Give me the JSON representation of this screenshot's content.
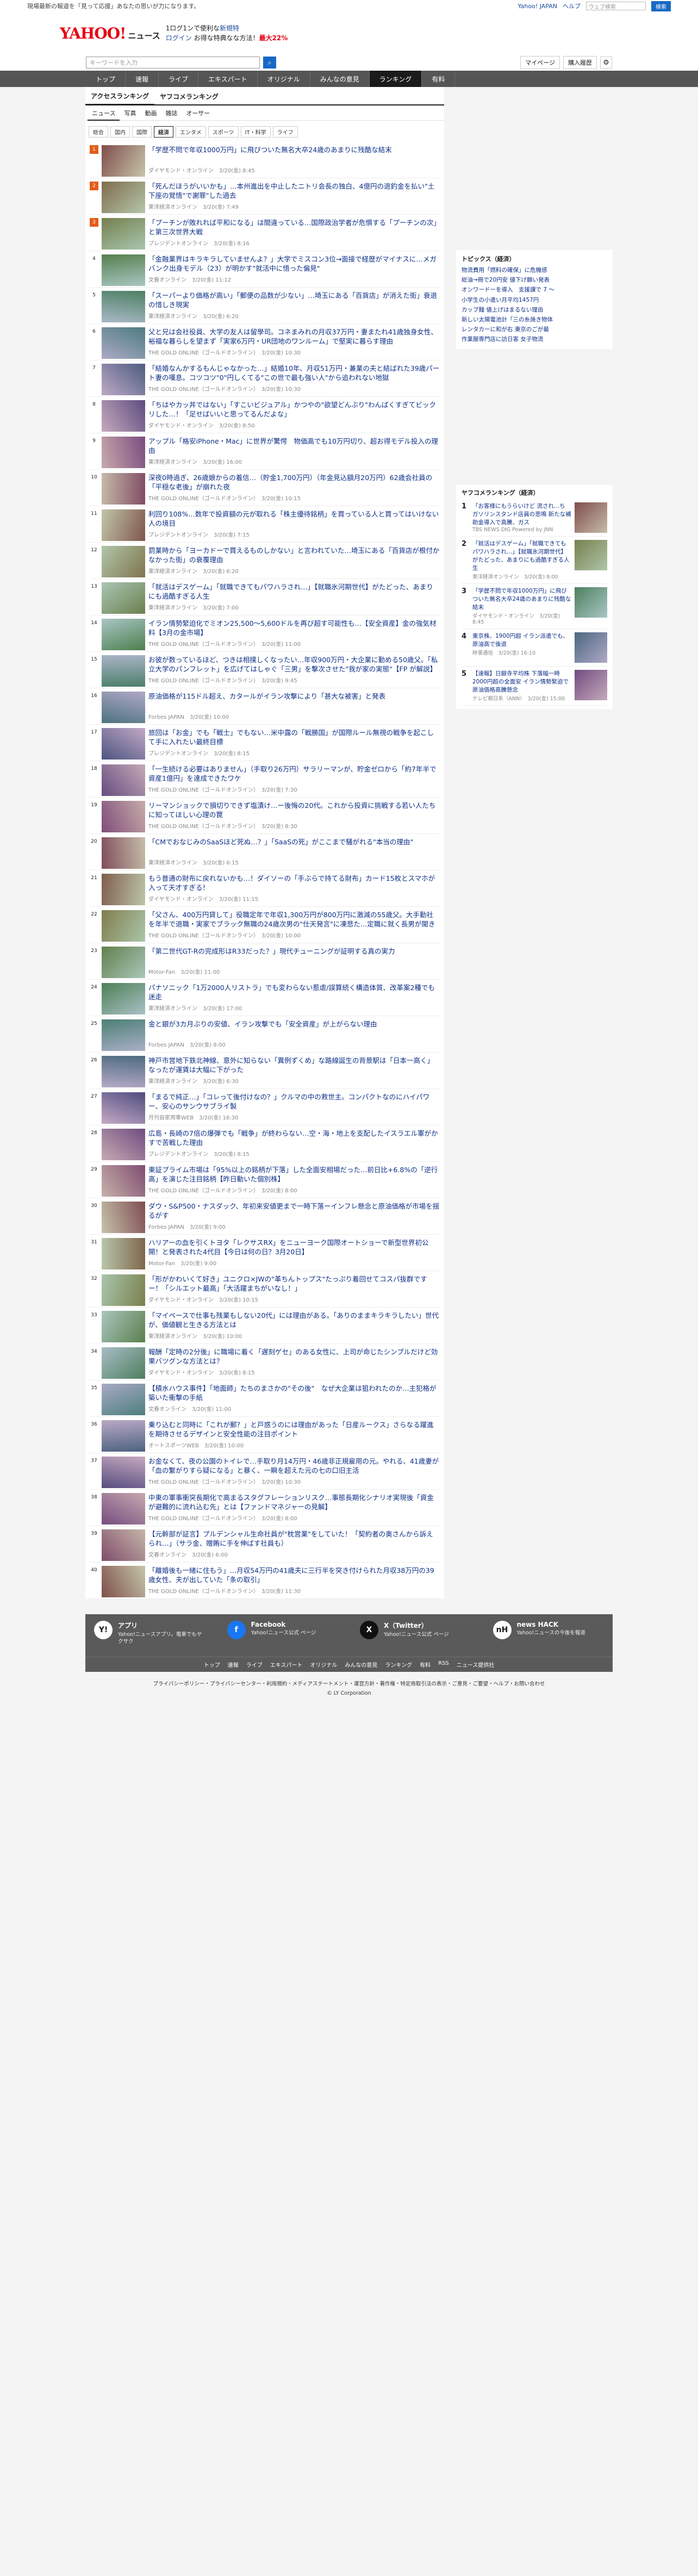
{
  "shortcuts": {
    "notice": "現場最新の報道を「見って応援」あなたの思いが力になります。",
    "yj": "Yahoo! JAPAN",
    "help": "ヘルプ",
    "search_ph": "ウェブ検索",
    "search_btn": "検索"
  },
  "header": {
    "logo": "YAHOO!",
    "logo_sub": "ニュース",
    "promo1": "1ログ1ンで使利な",
    "promo1b": "新規特",
    "promo2": "ログイン",
    "promo3": "お得な特典なな方法！",
    "promo4": "最大22%"
  },
  "search": {
    "placeholder": "キーワードを入力",
    "mypage": "マイページ",
    "subscribe": "購入履歴"
  },
  "nav": [
    "トップ",
    "速報",
    "ライブ",
    "エキスパート",
    "オリジナル",
    "みんなの意見",
    "ランキング",
    "有料"
  ],
  "tabs1": [
    "アクセスランキング",
    "ヤフコメランキング"
  ],
  "tabs2": [
    "ニュース",
    "写真",
    "動画",
    "雑誌",
    "オーサー"
  ],
  "cats": [
    "総合",
    "国内",
    "国際",
    "経済",
    "エンタメ",
    "スポーツ",
    "IT・科学",
    "ライフ"
  ],
  "items": [
    {
      "r": "1",
      "t": "「学歴不問で年収1000万円」に飛びついた無名大卒24歳のあまりに残酷な結末",
      "m": "ダイヤモンド・オンライン　3/20(金) 8:45"
    },
    {
      "r": "2",
      "t": "「死んだほうがいいかも」…本州進出を中止したニトリ会長の独白、4億円の退釣金を払い\"土下座の覚悟\"で謝罪\"した過去",
      "m": "東洋経済オンライン　3/20(金) 7:49"
    },
    {
      "r": "3",
      "t": "「プーチンが敗れれば平和になる」は間違っている…国際政治学者が危惧する「プーチンの次」と第三次世界大戦",
      "m": "プレジデントオンライン　3/20(金) 8:16"
    },
    {
      "r": "4",
      "t": "「金融業界はキラキラしていませんよ？」大学でミスコン3位→面接で経歴がマイナスに…メガバンク出身モデル（23）が明かす\"就活中に悟った偏見\"",
      "m": "文春オンライン　3/20(金) 11:12"
    },
    {
      "r": "5",
      "t": "「スーパーより価格が高い」「郵便の品数が少ない」…埼玉にある「百貨店」が消えた街」衰退の惜しき現実",
      "m": "東洋経済オンライン　3/20(金) 6:20"
    },
    {
      "r": "6",
      "t": "父と兄は会社役員、大学の友人は留學司。コネまみれの月収37万円・妻またれ41歳独身女性、裕福な暮らしを望まず「実家6万円・UR団地のワンルーム」で堅実に暮らす理由",
      "m": "THE GOLD ONLINE（ゴールドオンライン）　3/20(金) 10:30"
    },
    {
      "r": "7",
      "t": "「結婚なんかするもんじゃなかった…」結婚10年、月収51万円・兼業の夫と結ばれた39歳パート妻の嘆息。コツコツ\"0\"円しくてる\"この世で最も強い人\"から追われない地獄",
      "m": "THE GOLD ONLINE（ゴールドオンライン）　3/20(金) 10:30"
    },
    {
      "r": "8",
      "t": "「ちはやカッ丼ではない」「すこいビジュアル」かつやの\"欲望どんぶり\"わんぱくすぎてビックリした…！「足せばいいと思ってるんだよな」",
      "m": "ダイヤモンド・オンライン　3/20(金) 8:50"
    },
    {
      "r": "9",
      "t": "アップル「格安iPhone・Mac」に世界が驚愕　物価高でも10万円切り、超お得モデル投入の理由",
      "m": "東洋経済オンライン　3/20(金) 16:00"
    },
    {
      "r": "10",
      "t": "深夜0時過ぎ、26歳娘からの着信…（貯金1,700万円）（年金見込額月20万円）62歳会社員の「平穏な老後」が崩れた夜",
      "m": "THE GOLD ONLINE（ゴールドオンライン）　3/20(金) 10:15"
    },
    {
      "r": "11",
      "t": "利回り108%…数年で投資額の元が取れる「株主優待銘柄」を買っている人と買ってはいけない人の境目",
      "m": "プレジデントオンライン　3/20(金) 7:15"
    },
    {
      "r": "12",
      "t": "罰業時から「ヨーカドーで買えるものしかない」と言われていた…埼玉にある「百貨店が根付かなかった街」の衰覆理由",
      "m": "東洋経済オンライン　3/20(金) 6:20"
    },
    {
      "r": "13",
      "t": "「就活はデスゲーム」「就職できてもパワハラされ…」【就職氷河期世代】がたどった、あまりにも過酷すぎる人生",
      "m": "東洋経済オンライン　3/20(金) 7:00"
    },
    {
      "r": "14",
      "t": "イラン情勢緊迫化でミオン25,500〜5,600ドルを再び超す可能性も…【安全資産】金の強気材料【3月の金市場】",
      "m": "THE GOLD ONLINE（ゴールドオンライン）　3/20(金) 11:00"
    },
    {
      "r": "15",
      "t": "お彼が数っているほど、つきは相撲しくなったい…年収900万円・大企業に勤める50歳父。「私立大学のパンフレット」を広げてはしゃぐ「三男」を撃次させた\"我が家の実態\"【FP が解説】",
      "m": "THE GOLD ONLINE（ゴールドオンライン）　3/20(金) 9:45"
    },
    {
      "r": "16",
      "t": "原油価格が115ドル超え、カタールがイラン攻撃により「甚大な被害」と発表",
      "m": "Forbes JAPAN　3/20(金) 10:00"
    },
    {
      "r": "17",
      "t": "旅回は「お金」でも「戦士」でもない…米中露の「戦勝国」が国際ルール無視の戦争を起こして手に入れたい最終目標",
      "m": "プレジデントオンライン　3/20(金) 8:15"
    },
    {
      "r": "18",
      "t": "「一生続ける必要はありません」（手取り26万円）サラリーマンが、貯金ゼロから「約7年半で資産1億円」を達成できたワケ",
      "m": "THE GOLD ONLINE（ゴールドオンライン）　3/20(金) 7:30"
    },
    {
      "r": "19",
      "t": "リーマンショックで損切りできず塩漬け…ー後悔の20代。これから投資に挑戦する若い人たちに知ってほしい心理の罠",
      "m": "THE GOLD ONLINE（ゴールドオンライン）　3/20(金) 8:30"
    },
    {
      "r": "20",
      "t": "「CMでおなじみのSaaSほど死ぬ…？」「SaaSの死」がここまで騒がれる\"本当の理由\"",
      "m": "東洋経済オンライン　3/20(金) 6:15"
    },
    {
      "r": "21",
      "t": "もう普通の財布に戻れないかも…！ダイソーの「手ぶらで持てる財布」カード15枚とスマホが入って天才すぎる！",
      "m": "ダイヤモンド・オンライン　3/20(金) 11:15"
    },
    {
      "r": "22",
      "t": "「父さん、400万円貸して」役職定年で年収1,300万円が800万円に激減の55歳父。大手勤社を年半で退職・実家でブラック無職の24歳次男の\"仕天発言\"に凍悲た…定職に就く長男が聞き出した「残酷な真実」",
      "m": "THE GOLD ONLINE（ゴールドオンライン）　3/20(金) 10:00"
    },
    {
      "r": "23",
      "t": "「第二世代GT-Rの完成形はR33だった？」現代チューニングが証明する真の実力",
      "m": "Motor-Fan　3/20(金) 11:00"
    },
    {
      "r": "24",
      "t": "パナソニック「1万2000人リストラ」でも変わらない惹虐/誤算続く構造体質、改革案2種でも迷走",
      "m": "東洋経済オンライン　3/20(金) 17:00"
    },
    {
      "r": "25",
      "t": "金と銀が3カ月ぶりの安値、イラン攻撃でも「安全資産」が上がらない理由",
      "m": "Forbes JAPAN　3/20(金) 8:00"
    },
    {
      "r": "26",
      "t": "神戸市営地下鉄北神線、意外に知らない「異例ずくめ」な路線誕生の背景駅は「日本一高く」なったが運賃は大幅に下がった",
      "m": "東洋経済オンライン　3/20(金) 6:30"
    },
    {
      "r": "27",
      "t": "「まるで純正…」「コレって後付けなの？」クルマの中の救世主。コンパクトなのにハイパワー、安心のサンウサブライ製",
      "m": "月刊自家用車WEB　3/20(金) 16:30"
    },
    {
      "r": "28",
      "t": "広島・長崎の7倍の爆弾でも「戦争」が終わらない…空・海・地上を支配したイスラエル軍がかすで苦戦した理由",
      "m": "プレジデントオンライン　3/20(金) 8:15"
    },
    {
      "r": "29",
      "t": "東証プライム市場は「95%以上の銘柄が下落」した全面安相場だった…前日比+6.8%の「逆行高」を演じた注目銘柄【昨日動いた個別株】",
      "m": "THE GOLD ONLINE（ゴールドオンライン）　3/20(金) 8:00"
    },
    {
      "r": "30",
      "t": "ダウ・S&P500・ナスダック、年初来安値更まで一時下落ーインフレ懸念と原油価格が市場を揺るがす",
      "m": "Forbes JAPAN　3/20(金) 9:00"
    },
    {
      "r": "31",
      "t": "ハリアーの血を引くトヨタ「レクサスRX」をニューヨーク国際オートショーで新型世界初公開！と発表された4代目【今日は何の日？3月20日】",
      "m": "Motor-Fan　3/20(金) 9:00"
    },
    {
      "r": "32",
      "t": "「形がかわいくて好き」ユニクロ×JWの\"革ちんトップス\"たっぷり着回せてコスパ抜群ですー！「シルエット最高」「大活躍まちがいなし！」",
      "m": "ダイヤモンド・オンライン　3/20(金) 10:15"
    },
    {
      "r": "33",
      "t": "「マイペースで仕事も残業もしない20代」には理由がある。「ありのままキラキラしたい」世代が、価値観と生きる方法とは",
      "m": "東洋経済オンライン　3/20(金) 10:00"
    },
    {
      "r": "34",
      "t": "報酬「定時の2分後」に職場に着く「遅刻ゲセ」のある女性に、上司が命じたシンプルだけど効果バツグンな方法とは？",
      "m": "ダイヤモンド・オンライン　3/20(金) 8:15"
    },
    {
      "r": "35",
      "t": "【積水ハウス事件】「地面師」たちのまさかの\"その後\"　なぜ大企業は狙われたのか…主犯格が築いた衝撃の手紙",
      "m": "文春オンライン　3/20(金) 11:00"
    },
    {
      "r": "36",
      "t": "乗り込むと同時に「これが郵？」と戸惑うのには理由があった「日産ルークス」さらなる躍進を期待させるデザインと安全性能の注目ポイント",
      "m": "オートスポーツWEB　3/20(金) 10:00"
    },
    {
      "r": "37",
      "t": "お金なくて、夜の公園のトイレで…手取り月14万円・46歳非正規雇用の元。やれる、41歳妻が「血の繋がりすら疑になる」と暴く、一瞬を超えた元の七の口旧主活",
      "m": "THE GOLD ONLINE（ゴールドオンライン）　3/20(金) 10:30"
    },
    {
      "r": "38",
      "t": "中東の軍事衝突長期化で高まるスタグフレーションリスク…事態長期化シナリオ実現後「資金が避難的に流れ込む先」とは【ファンドマネジャーの見解】",
      "m": "THE GOLD ONLINE（ゴールドオンライン）　3/20(金) 8:00"
    },
    {
      "r": "39",
      "t": "【元幹部が証言】プルデンシャル生命社員が\"枕営業\"をしていた！「契約者の奥さんから訴えられ…」（サラ金、贈賄に手を伸ばす社員も）",
      "m": "文春オンライン　3/20(金) 6:00"
    },
    {
      "r": "40",
      "t": "「離婚後も一緒に住もう」…月収54万円の41歳夫に三行半を突き付けられた月収38万円の39歳女性、夫が出していた「条の取引」",
      "m": "THE GOLD ONLINE（ゴールドオンライン）　3/20(金) 11:30"
    }
  ],
  "topics": {
    "head": "トピックス（経済）",
    "items": [
      "物流費用「燃料の確保」に危機感",
      "総油→冊で20円安 値下げ願い発表",
      "オンワードーを導入　支援課で 7 ～",
      "小学生の小遣い月平均1457円",
      "カップ麺 値上げはまるない理由",
      "新しい太陽電池計「三の糸焼き物体",
      "レンタカーに和が右 東京のごが最",
      "作業服専門店に訪日客 女子物流"
    ]
  },
  "yahoo_rank": {
    "head": "ヤフコメランキング（経済）",
    "items": [
      {
        "n": "1",
        "t": "「お客様にもうらいけど 流され...ち ガソリンスタンド店員の悲鳴 新たな補助金導入で高騰、ガス",
        "m": "TBS NEWS DIG Powered by JNN"
      },
      {
        "n": "2",
        "t": "「就活はデスゲーム」「就職できてもパワハラされ…」【就職氷河期世代】がたどった、あまりにも過酷すぎる人生",
        "m": "東洋経済オンライン　3/20(金) 8:00"
      },
      {
        "n": "3",
        "t": "「学歴不問で年収1000万円」に飛びついた無名大卒24歳のあまりに残酷な結末",
        "m": "ダイヤモンド・オンライン　3/20(金) 8:45"
      },
      {
        "n": "4",
        "t": "東京株、1900円超 イラン派遣でも、原油高で後退",
        "m": "時事通信　3/20(金) 16:10"
      },
      {
        "n": "5",
        "t": "【速報】日銀寺平均株 下落幅一時2000円超の全面安 イラン情勢緊迫で原油価格高騰懸念",
        "m": "テレビ朝日系（ANN）　3/20(金) 15:00"
      }
    ]
  },
  "footer": {
    "cols": [
      {
        "h": "アプリ",
        "s": "Yahoo!ニュースアプリ。電車でもヤクサク",
        "i": "Y!"
      },
      {
        "h": "Facebook",
        "s": "Yahoo!ニュース公式 ページ",
        "i": "f"
      },
      {
        "h": "X（Twitter）",
        "s": "Yahoo!ニュース公式 ページ",
        "i": "X"
      },
      {
        "h": "news HACK",
        "s": "Yahoo!ニュースの今後を報道",
        "i": "nH"
      }
    ],
    "links": [
      "トップ",
      "速報",
      "ライブ",
      "エキスパート",
      "オリジナル",
      "みんなの意見",
      "ランキング",
      "有料",
      "RSS",
      "ニュース提供社"
    ],
    "legal": "プライバシーポリシー・プライバシーセンター・利用規約・メディアステートメント・運営方針・著作権・特定商取引法の表示・ご意見・ご要望・ヘルプ・お問い合わせ",
    "copy": "© LY Corporation"
  }
}
